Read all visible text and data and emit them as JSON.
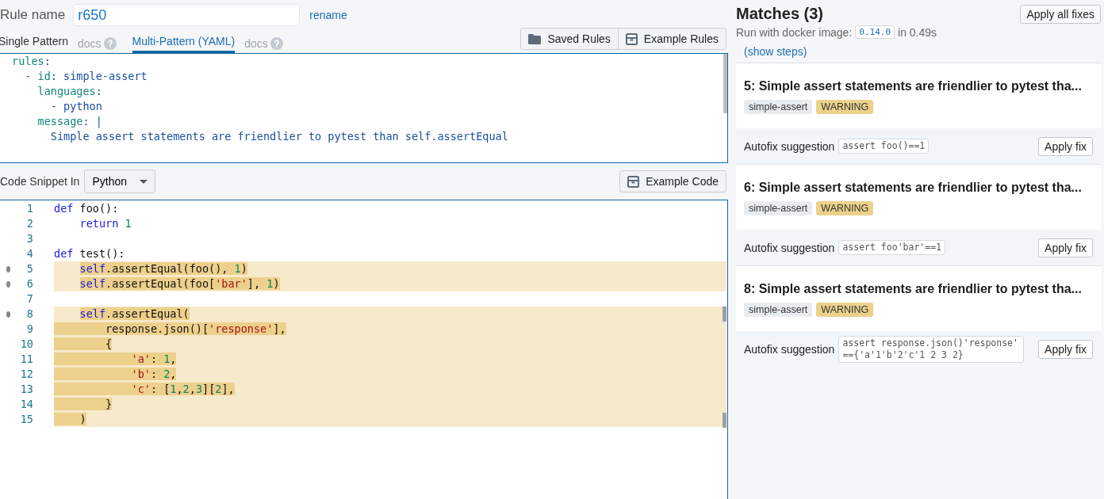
{
  "rule_name": {
    "label": "Rule name",
    "value": "r650",
    "rename": "rename"
  },
  "tabs": [
    {
      "label": "Single Pattern",
      "docs": "docs",
      "selected": false
    },
    {
      "label": "Multi-Pattern (YAML)",
      "docs": "docs",
      "selected": true
    }
  ],
  "rule_buttons": [
    "Saved Rules",
    "Example Rules"
  ],
  "yaml_lines": [
    [
      {
        "text": "rules",
        "kind": "key"
      },
      {
        "text": ":",
        "kind": "plain"
      }
    ],
    [
      {
        "text": "  - ",
        "kind": "plain"
      },
      {
        "text": "id",
        "kind": "key"
      },
      {
        "text": ": simple-assert",
        "kind": "plain"
      }
    ],
    [
      {
        "text": "    languages",
        "kind": "key"
      },
      {
        "text": ":",
        "kind": "plain"
      }
    ],
    [
      {
        "text": "      - python",
        "kind": "plain"
      }
    ],
    [
      {
        "text": "    message",
        "kind": "key"
      },
      {
        "text": ": |",
        "kind": "plain"
      }
    ],
    [
      {
        "text": "      Simple assert statements are friendlier to pytest than self.assertEqual",
        "kind": "plain"
      }
    ]
  ],
  "snippet": {
    "label": "Code Snippet In",
    "language": "Python",
    "example_button": "Example Code"
  },
  "code_lines": [
    {
      "number": "1",
      "match": false,
      "dot": false,
      "tokens": [
        {
          "text": "def",
          "kind": "keyword",
          "hl": false
        },
        {
          "text": " foo():",
          "kind": "plain",
          "hl": false
        }
      ]
    },
    {
      "number": "2",
      "match": false,
      "dot": false,
      "tokens": [
        {
          "text": "    return",
          "kind": "keyword",
          "hl": false
        },
        {
          "text": " 1",
          "kind": "number",
          "hl": false
        }
      ]
    },
    {
      "number": "3",
      "match": false,
      "dot": false
    },
    {
      "number": "4",
      "match": false,
      "dot": false,
      "tokens": [
        {
          "text": "def",
          "kind": "keyword",
          "hl": false
        },
        {
          "text": " test():",
          "kind": "plain",
          "hl": false
        }
      ]
    },
    {
      "number": "5",
      "match": true,
      "dot": true,
      "indent_hl": false,
      "tokens": [
        {
          "text": "    self",
          "kind": "keyword",
          "hl": true
        },
        {
          "text": ".assertEqual(foo(), ",
          "kind": "plain",
          "hl": true
        },
        {
          "text": "1",
          "kind": "number",
          "hl": true
        },
        {
          "text": ")",
          "kind": "plain",
          "hl": true
        }
      ]
    },
    {
      "number": "6",
      "match": true,
      "dot": true,
      "indent_hl": false,
      "tokens": [
        {
          "text": "    self",
          "kind": "keyword",
          "hl": true
        },
        {
          "text": ".assertEqual(foo[",
          "kind": "plain",
          "hl": true
        },
        {
          "text": "'bar'",
          "kind": "string",
          "hl": true
        },
        {
          "text": "], ",
          "kind": "plain",
          "hl": true
        },
        {
          "text": "1",
          "kind": "number",
          "hl": true
        },
        {
          "text": ")",
          "kind": "plain",
          "hl": true
        }
      ]
    },
    {
      "number": "7",
      "match": false,
      "dot": false
    },
    {
      "number": "8",
      "match": true,
      "dot": true,
      "indent_hl": false,
      "tokens": [
        {
          "text": "    self",
          "kind": "keyword",
          "hl": true
        },
        {
          "text": ".assertEqual(",
          "kind": "plain",
          "hl": true
        }
      ]
    },
    {
      "number": "9",
      "match": true,
      "dot": false,
      "indent_hl": true,
      "tokens": [
        {
          "text": "        response.json()[",
          "kind": "plain",
          "hl": true
        },
        {
          "text": "'response'",
          "kind": "string",
          "hl": true
        },
        {
          "text": "],",
          "kind": "plain",
          "hl": true
        }
      ]
    },
    {
      "number": "10",
      "match": true,
      "dot": false,
      "indent_hl": true,
      "tokens": [
        {
          "text": "        {",
          "kind": "plain",
          "hl": true
        }
      ]
    },
    {
      "number": "11",
      "match": true,
      "dot": false,
      "indent_hl": true,
      "tokens": [
        {
          "text": "            'a'",
          "kind": "string",
          "hl": true
        },
        {
          "text": ": ",
          "kind": "plain",
          "hl": true
        },
        {
          "text": "1",
          "kind": "number",
          "hl": true
        },
        {
          "text": ",",
          "kind": "plain",
          "hl": true
        }
      ]
    },
    {
      "number": "12",
      "match": true,
      "dot": false,
      "indent_hl": true,
      "tokens": [
        {
          "text": "            'b'",
          "kind": "string",
          "hl": true
        },
        {
          "text": ": ",
          "kind": "plain",
          "hl": true
        },
        {
          "text": "2",
          "kind": "number",
          "hl": true
        },
        {
          "text": ",",
          "kind": "plain",
          "hl": true
        }
      ]
    },
    {
      "number": "13",
      "match": true,
      "dot": false,
      "indent_hl": true,
      "tokens": [
        {
          "text": "            'c'",
          "kind": "string",
          "hl": true
        },
        {
          "text": ": [",
          "kind": "plain",
          "hl": true
        },
        {
          "text": "1",
          "kind": "number",
          "hl": true
        },
        {
          "text": ",",
          "kind": "plain",
          "hl": true
        },
        {
          "text": "2",
          "kind": "number",
          "hl": true
        },
        {
          "text": ",",
          "kind": "plain",
          "hl": true
        },
        {
          "text": "3",
          "kind": "number",
          "hl": true
        },
        {
          "text": "][",
          "kind": "plain",
          "hl": true
        },
        {
          "text": "2",
          "kind": "number",
          "hl": true
        },
        {
          "text": "],",
          "kind": "plain",
          "hl": true
        }
      ]
    },
    {
      "number": "14",
      "match": true,
      "dot": false,
      "indent_hl": true,
      "tokens": [
        {
          "text": "        }",
          "kind": "plain",
          "hl": true
        }
      ]
    },
    {
      "number": "15",
      "match": true,
      "dot": false,
      "indent_hl": true,
      "tokens": [
        {
          "text": "    )",
          "kind": "plain",
          "hl": true
        }
      ]
    }
  ],
  "matches": {
    "title": "Matches (3)",
    "apply_all": "Apply all fixes",
    "run_label": "Run with docker image:",
    "version": "0.14.0",
    "time": "in 0.49s",
    "show_steps": "(show steps)",
    "items": [
      {
        "title": "5: Simple assert statements are friendlier to pytest tha...",
        "tags": [
          {
            "label": "simple-assert",
            "color": "#e9ecef"
          },
          {
            "label": "WARNING",
            "color": "#ecd18b"
          }
        ],
        "autofix_label": "Autofix suggestion",
        "autofix": "assert foo()==1",
        "apply": "Apply fix"
      },
      {
        "title": "6: Simple assert statements are friendlier to pytest tha...",
        "tags": [
          {
            "label": "simple-assert",
            "color": "#e9ecef"
          },
          {
            "label": "WARNING",
            "color": "#ecd18b"
          }
        ],
        "autofix_label": "Autofix suggestion",
        "autofix": "assert foo'bar'==1",
        "apply": "Apply fix"
      },
      {
        "title": "8: Simple assert statements are friendlier to pytest tha...",
        "tags": [
          {
            "label": "simple-assert",
            "color": "#e9ecef"
          },
          {
            "label": "WARNING",
            "color": "#ecd18b"
          }
        ],
        "autofix_label": "Autofix suggestion",
        "autofix": "assert response.json()'response' =={'a'1'b'2'c'1 2 3 2}",
        "apply": "Apply fix"
      }
    ]
  }
}
